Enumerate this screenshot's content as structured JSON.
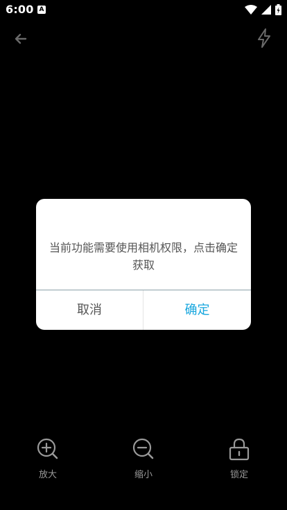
{
  "status_bar": {
    "time": "6:00",
    "notification_glyph": "A"
  },
  "toolbar": {
    "back_icon": "arrow-left-icon",
    "flash_icon": "flash-icon"
  },
  "dialog": {
    "message": "当前功能需要使用相机权限，点击确定获取",
    "cancel_label": "取消",
    "confirm_label": "确定",
    "confirm_color": "#16a6de"
  },
  "controls": {
    "zoom_in_label": "放大",
    "zoom_out_label": "缩小",
    "lock_label": "锁定",
    "icon_color": "#9a9a9a"
  }
}
